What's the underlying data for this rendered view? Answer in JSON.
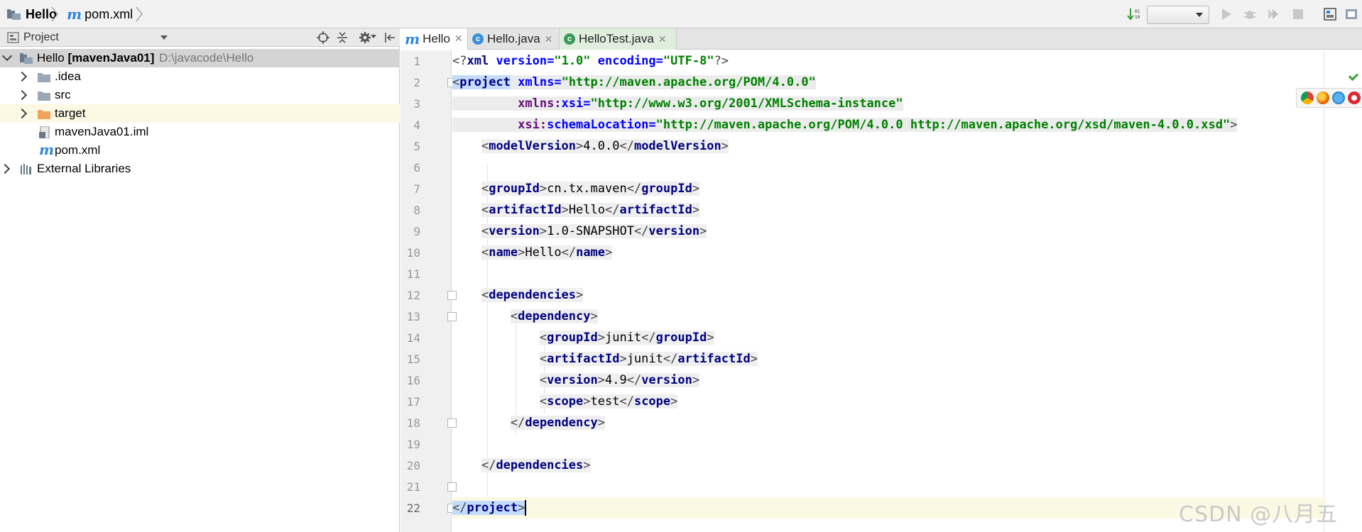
{
  "navbar": {
    "breadcrumb_root": "Hello",
    "breadcrumb_file": "pom.xml"
  },
  "project_panel": {
    "title": "Project",
    "tree": [
      {
        "label": "Hello",
        "label_bold": "[mavenJava01]",
        "path": "D:\\javacode\\Hello",
        "type": "module",
        "expanded": true
      },
      {
        "label": ".idea",
        "type": "folder"
      },
      {
        "label": "src",
        "type": "folder"
      },
      {
        "label": "target",
        "type": "folder-orange"
      },
      {
        "label": "mavenJava01.iml",
        "type": "iml"
      },
      {
        "label": "pom.xml",
        "type": "maven"
      },
      {
        "label": "External Libraries",
        "type": "libraries"
      }
    ]
  },
  "editor": {
    "tabs": [
      {
        "label": "Hello",
        "icon": "maven-icon",
        "active": true
      },
      {
        "label": "Hello.java",
        "icon": "java-class-icon",
        "active": false
      },
      {
        "label": "HelloTest.java",
        "icon": "java-test-class-icon",
        "active": false
      }
    ],
    "line_numbers": [
      "1",
      "2",
      "3",
      "4",
      "5",
      "6",
      "7",
      "8",
      "9",
      "10",
      "11",
      "12",
      "13",
      "14",
      "15",
      "16",
      "17",
      "18",
      "19",
      "20",
      "21",
      "22"
    ],
    "code": {
      "l1": {
        "open": "<?",
        "tag": "xml",
        "a1": " version",
        "eq1": "=",
        "v1": "\"1.0\"",
        "a2": " encoding",
        "eq2": "=",
        "v2": "\"UTF-8\"",
        "close": "?>"
      },
      "l2": {
        "open": "<",
        "tag": "project",
        "attr": " xmlns",
        "eq": "=",
        "val": "\"http://maven.apache.org/POM/4.0.0\""
      },
      "l3": {
        "ns": "xmlns:",
        "attr": "xsi",
        "eq": "=",
        "val": "\"http://www.w3.org/2001/XMLSchema-instance\""
      },
      "l4": {
        "ns": "xsi:",
        "attr": "schemaLocation",
        "eq": "=",
        "val": "\"http://maven.apache.org/POM/4.0.0 http://maven.apache.org/xsd/maven-4.0.0.xsd\"",
        "close": ">"
      },
      "l5": {
        "tag": "modelVersion",
        "text": "4.0.0"
      },
      "l7": {
        "tag": "groupId",
        "text": "cn.tx.maven"
      },
      "l8": {
        "tag": "artifactId",
        "text": "Hello"
      },
      "l9": {
        "tag": "version",
        "text": "1.0-SNAPSHOT"
      },
      "l10": {
        "tag": "name",
        "text": "Hello"
      },
      "l12": {
        "tag": "dependencies"
      },
      "l13": {
        "tag": "dependency"
      },
      "l14": {
        "tag": "groupId",
        "text": "junit"
      },
      "l15": {
        "tag": "artifactId",
        "text": "junit"
      },
      "l16": {
        "tag": "version",
        "text": "4.9"
      },
      "l17": {
        "tag": "scope",
        "text": "test"
      },
      "l18": {
        "tag": "dependency"
      },
      "l20": {
        "tag": "dependencies"
      },
      "l22": {
        "tag": "project"
      }
    }
  },
  "watermark": "CSDN @八月五",
  "colors": {
    "tag": "#000080",
    "attribute": "#0000ff",
    "namespace": "#660e7a",
    "string": "#008000",
    "caret_line": "#fbf9e4",
    "selection": "#d4d4d4"
  }
}
